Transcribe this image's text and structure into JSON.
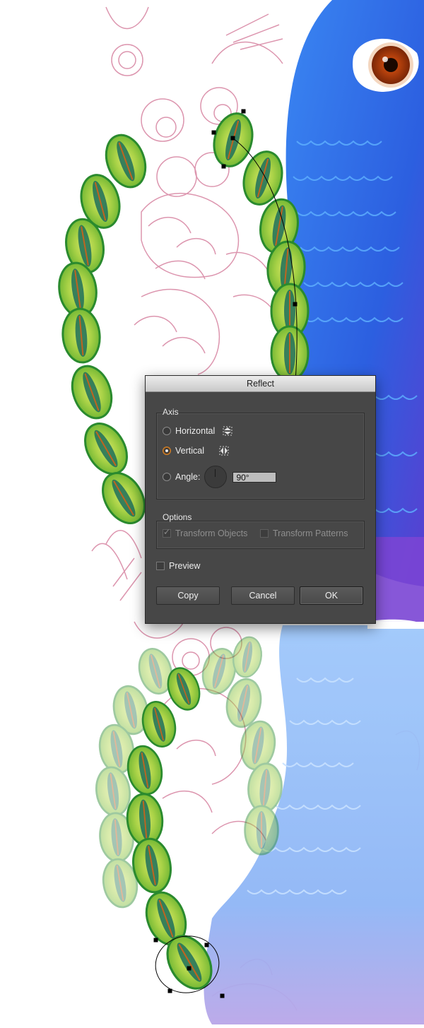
{
  "dialog": {
    "title": "Reflect",
    "axis": {
      "label": "Axis",
      "options": [
        {
          "label": "Horizontal",
          "checked": false,
          "icon": "reflect-horizontal-icon"
        },
        {
          "label": "Vertical",
          "checked": true,
          "icon": "reflect-vertical-icon"
        },
        {
          "label": "Angle:",
          "checked": false,
          "icon": "angle-dial-icon"
        }
      ],
      "angle_value": "90°"
    },
    "options": {
      "label": "Options",
      "transform_objects": {
        "label": "Transform Objects",
        "checked": true,
        "enabled": false
      },
      "transform_patterns": {
        "label": "Transform Patterns",
        "checked": false,
        "enabled": false
      }
    },
    "preview": {
      "label": "Preview",
      "checked": false
    },
    "buttons": {
      "copy": "Copy",
      "cancel": "Cancel",
      "ok": "OK"
    }
  },
  "colors": {
    "dialog_bg": "#474747",
    "feather_green": "#8dc63f",
    "feather_outline": "#2a8a2e",
    "peacock_blue": "#2f6fe0",
    "sketch_pink": "#d98aa6",
    "radio_accent": "#d9852a"
  }
}
